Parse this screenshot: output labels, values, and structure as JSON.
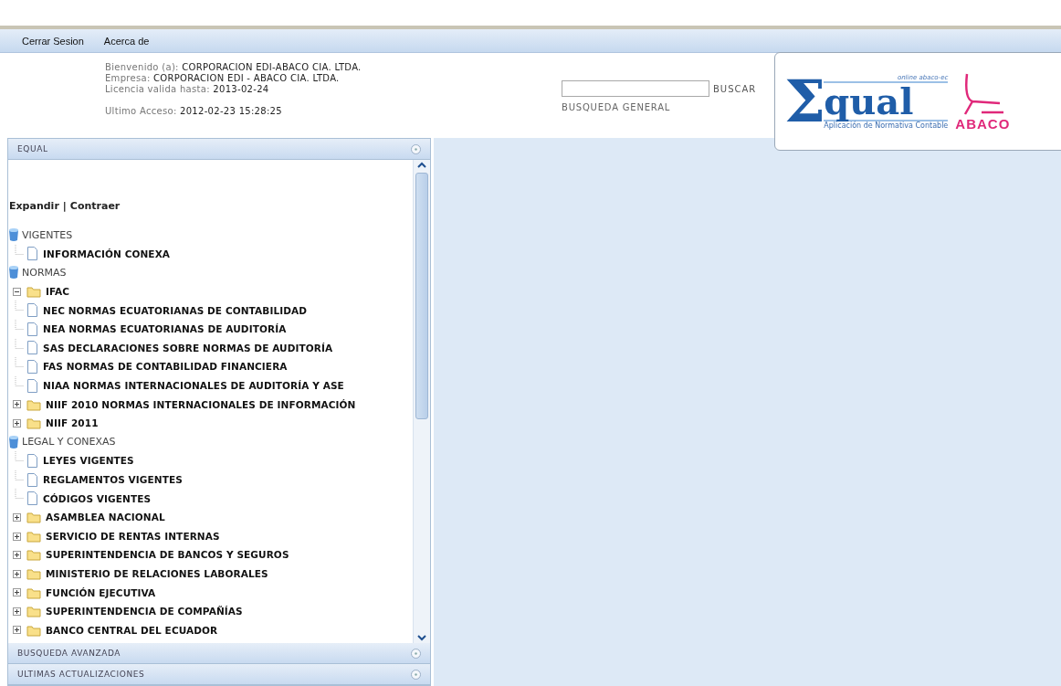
{
  "menu": [
    {
      "label": "Cerrar Sesion"
    },
    {
      "label": "Acerca de"
    }
  ],
  "header": {
    "lines": [
      "Bienvenido (a): **CORPORACION EDI-ABACO CIA. LTDA.**",
      "Empresa: **CORPORACION EDI - ABACO CIA. LTDA.**",
      "Licencia valida hasta: **2013-02-24**"
    ],
    "last_access": "Ultimo Acceso: **2012-02-23 15:28:25**"
  },
  "search": {
    "button": "BUSCAR",
    "caption": "BUSQUEDA GENERAL"
  },
  "logo": {
    "symbol": "Σ",
    "word": "qual",
    "tagline": "online abaco-ec",
    "subtitle": "Aplicación de Normativa Contable",
    "brand": "ABACO"
  },
  "panels": [
    {
      "title": "EQUAL",
      "expanded": true
    },
    {
      "title": "BUSQUEDA AVANZADA",
      "expanded": false
    },
    {
      "title": "ULTIMAS ACTUALIZACIONES",
      "expanded": false
    }
  ],
  "tree_links": [
    "Expandir",
    "Contraer"
  ],
  "tree_links_separator": "|",
  "tree": [
    {
      "label": "VIGENTES",
      "kind": "root",
      "children": [
        {
          "label": "INFORMACIÓN CONEXA",
          "kind": "doc"
        }
      ]
    },
    {
      "label": "NORMAS",
      "kind": "root",
      "children": [
        {
          "label": "IFAC",
          "kind": "folder",
          "expanded": true
        },
        {
          "label": "NEC NORMAS ECUATORIANAS DE CONTABILIDAD",
          "kind": "doc"
        },
        {
          "label": "NEA NORMAS ECUATORIANAS DE AUDITORÍA",
          "kind": "doc"
        },
        {
          "label": "SAS DECLARACIONES SOBRE NORMAS DE AUDITORÍA",
          "kind": "doc"
        },
        {
          "label": "FAS NORMAS DE CONTABILIDAD FINANCIERA",
          "kind": "doc"
        },
        {
          "label": "NIAA NORMAS INTERNACIONALES DE AUDITORÍA Y ASE",
          "kind": "doc"
        },
        {
          "label": "NIIF 2010 NORMAS INTERNACIONALES DE INFORMACIÓN",
          "kind": "folder",
          "expanded": false
        },
        {
          "label": "NIIF 2011",
          "kind": "folder",
          "expanded": false
        }
      ]
    },
    {
      "label": "LEGAL Y CONEXAS",
      "kind": "root",
      "children": [
        {
          "label": "LEYES VIGENTES",
          "kind": "doc"
        },
        {
          "label": "REGLAMENTOS VIGENTES",
          "kind": "doc"
        },
        {
          "label": "CÓDIGOS VIGENTES",
          "kind": "doc"
        },
        {
          "label": "ASAMBLEA NACIONAL",
          "kind": "folder",
          "expanded": false
        },
        {
          "label": "SERVICIO DE RENTAS INTERNAS",
          "kind": "folder",
          "expanded": false
        },
        {
          "label": "SUPERINTENDENCIA DE BANCOS Y SEGUROS",
          "kind": "folder",
          "expanded": false
        },
        {
          "label": "MINISTERIO DE RELACIONES LABORALES",
          "kind": "folder",
          "expanded": false
        },
        {
          "label": "FUNCIÓN EJECUTIVA",
          "kind": "folder",
          "expanded": false
        },
        {
          "label": "SUPERINTENDENCIA DE COMPAÑÍAS",
          "kind": "folder",
          "expanded": false
        },
        {
          "label": "BANCO CENTRAL DEL ECUADOR",
          "kind": "folder",
          "expanded": false
        }
      ]
    }
  ]
}
